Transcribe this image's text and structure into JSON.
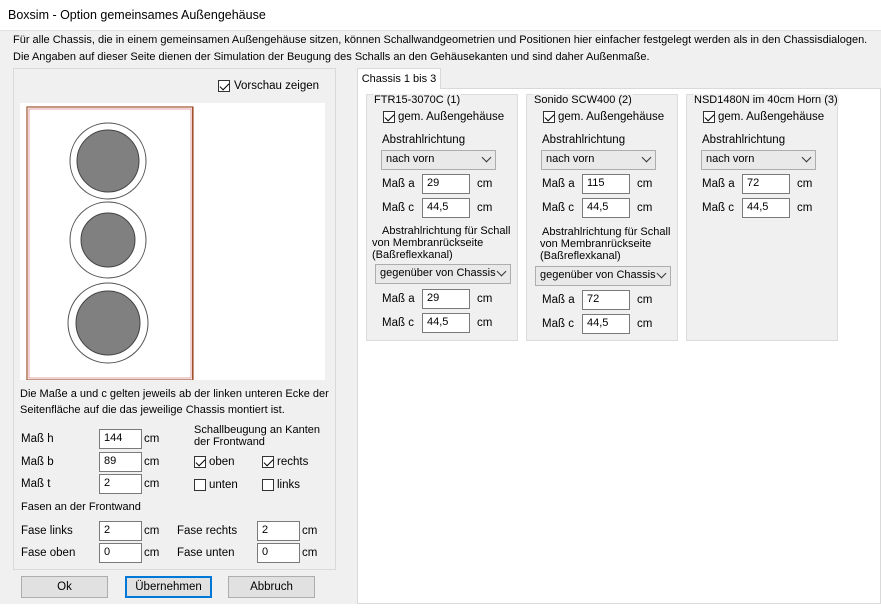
{
  "window": {
    "title": "Boxsim - Option gemeinsames Außengehäuse"
  },
  "info": {
    "line1": "Für alle Chassis, die in einem gemeinsamen Außengehäuse sitzen, können Schallwandgeometrien und Positionen hier einfacher festgelegt werden als in den Chassisdialogen.",
    "line2": "Die Angaben auf dieser Seite dienen der Simulation der  Beugung des Schalls an den Gehäusekanten und sind daher Außenmaße."
  },
  "preview": {
    "checkbox_label": "Vorschau zeigen",
    "checked": true
  },
  "note": {
    "line1": "Die Maße a und c gelten jeweils ab der linken unteren Ecke der",
    "line2": "Seitenfläche auf die das jeweilige Chassis montiert ist."
  },
  "dims": {
    "h": {
      "label": "Maß h",
      "value": "144",
      "unit": "cm"
    },
    "b": {
      "label": "Maß b",
      "value": "89",
      "unit": "cm"
    },
    "t": {
      "label": "Maß t",
      "value": "2",
      "unit": "cm"
    }
  },
  "diffraction": {
    "heading1": "Schallbeugung an Kanten",
    "heading2": "der Frontwand",
    "oben": {
      "label": "oben",
      "checked": true
    },
    "rechts": {
      "label": "rechts",
      "checked": true
    },
    "unten": {
      "label": "unten",
      "checked": false
    },
    "links": {
      "label": "links",
      "checked": false
    }
  },
  "bevels": {
    "heading": "Fasen an der Frontwand",
    "links": {
      "label": "Fase links",
      "value": "2",
      "unit": "cm"
    },
    "rechts": {
      "label": "Fase rechts",
      "value": "2",
      "unit": "cm"
    },
    "oben": {
      "label": "Fase oben",
      "value": "0",
      "unit": "cm"
    },
    "unten": {
      "label": "Fase unten",
      "value": "0",
      "unit": "cm"
    }
  },
  "buttons": {
    "ok": "Ok",
    "apply": "Übernehmen",
    "cancel": "Abbruch"
  },
  "tab": {
    "label": "Chassis 1 bis 3"
  },
  "chassis": [
    {
      "title": "FTR15-3070C (1)",
      "shared_label": "gem. Außengehäuse",
      "shared_checked": true,
      "dir_label": "Abstrahlrichtung",
      "dir_value": "nach vorn",
      "a_label": "Maß a",
      "a_value": "29",
      "c_label": "Maß c",
      "c_value": "44,5",
      "unit": "cm",
      "rear_label1": "Abstrahlrichtung für Schall",
      "rear_label2": "von Membranrückseite",
      "rear_label3": "(Baßreflexkanal)",
      "rear_value": "gegenüber von Chassis",
      "ra_value": "29",
      "rc_value": "44,5"
    },
    {
      "title": "Sonido SCW400 (2)",
      "shared_label": "gem. Außengehäuse",
      "shared_checked": true,
      "dir_label": "Abstrahlrichtung",
      "dir_value": "nach vorn",
      "a_label": "Maß a",
      "a_value": "115",
      "c_label": "Maß c",
      "c_value": "44,5",
      "unit": "cm",
      "rear_label1": "Abstrahlrichtung für Schall",
      "rear_label2": "von Membranrückseite",
      "rear_label3": "(Baßreflexkanal)",
      "rear_value": "gegenüber von Chassis",
      "ra_value": "72",
      "rc_value": "44,5"
    },
    {
      "title": "NSD1480N im 40cm Horn (3)",
      "shared_label": "gem. Außengehäuse",
      "shared_checked": true,
      "dir_label": "Abstrahlrichtung",
      "dir_value": "nach vorn",
      "a_label": "Maß a",
      "a_value": "72",
      "c_label": "Maß c",
      "c_value": "44,5",
      "unit": "cm"
    }
  ]
}
